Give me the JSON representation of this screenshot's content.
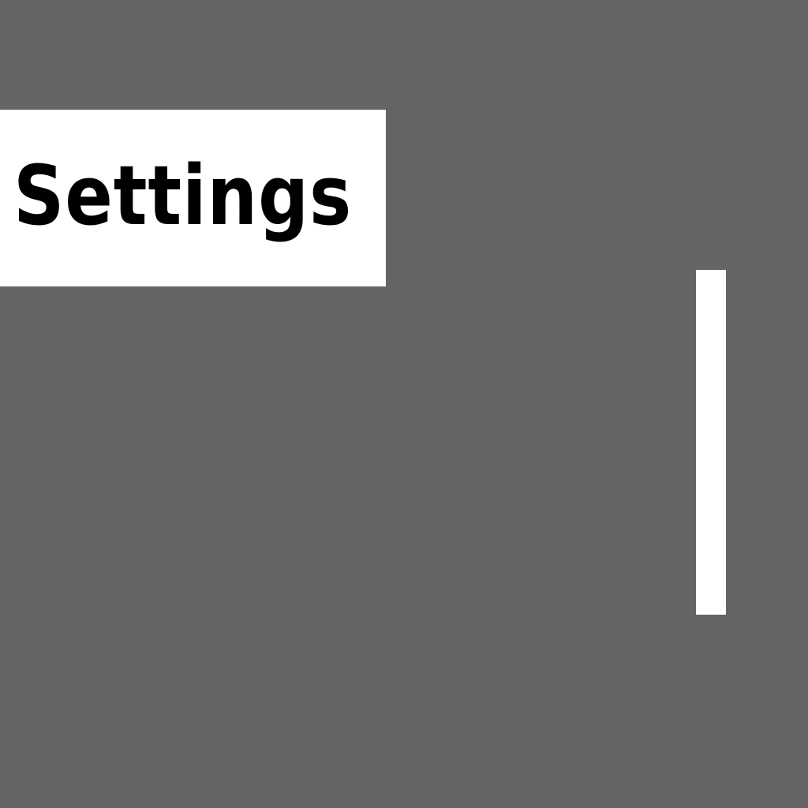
{
  "header": {
    "title": "Settings"
  },
  "colors": {
    "background": "#646464",
    "panel": "#ffffff",
    "text": "#000000",
    "scrollbar": "#ffffff"
  },
  "scrollbar": {
    "visible_fraction": 1.0,
    "position_fraction": 0.0
  }
}
